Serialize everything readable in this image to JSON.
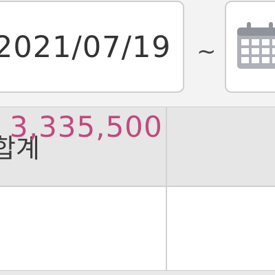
{
  "date_filter": {
    "start_date": "2021/07/19",
    "separator": "~",
    "calendar_icon": "calendar-icon"
  },
  "table": {
    "headers": [
      "합계",
      ""
    ],
    "rows": [
      {
        "total": "3,335,500",
        "second": ""
      }
    ]
  },
  "colors": {
    "amount_text": "#c04a7e",
    "header_bg": "#e6e6e6",
    "border": "#cfcfcf"
  }
}
